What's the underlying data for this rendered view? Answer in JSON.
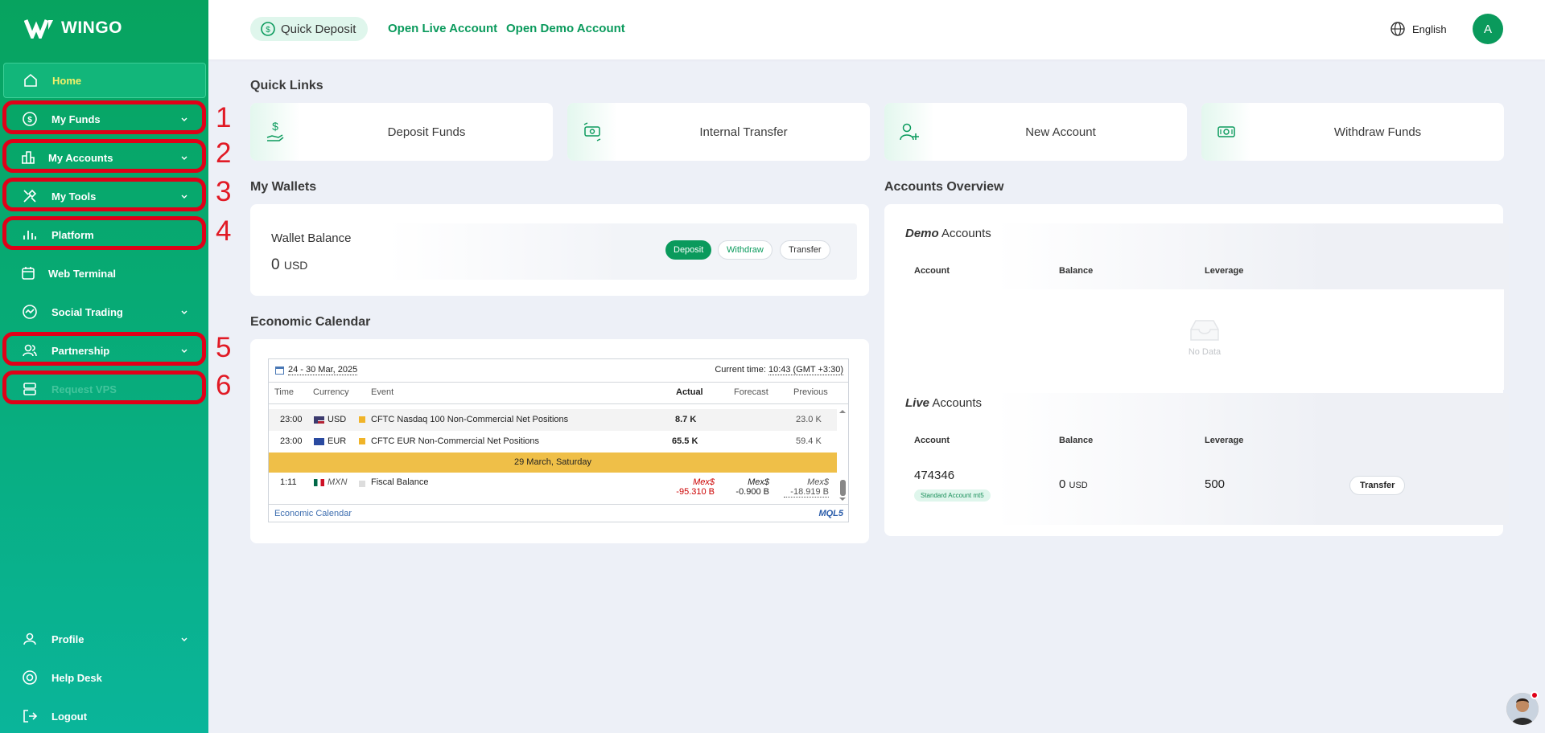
{
  "brand": {
    "name": "WINGO"
  },
  "sidebar": {
    "items": [
      {
        "label": "Home"
      },
      {
        "label": "My Funds"
      },
      {
        "label": "My Accounts"
      },
      {
        "label": "My Tools"
      },
      {
        "label": "Platform"
      },
      {
        "label": "Web Terminal"
      },
      {
        "label": "Social Trading"
      },
      {
        "label": "Partnership"
      },
      {
        "label": "Request VPS"
      },
      {
        "label": "Profile"
      },
      {
        "label": "Help Desk"
      },
      {
        "label": "Logout"
      }
    ],
    "annotations": [
      "1",
      "2",
      "3",
      "4",
      "5",
      "6"
    ]
  },
  "header": {
    "quick_deposit": "Quick Deposit",
    "open_live": "Open Live Account",
    "open_demo": "Open Demo Account",
    "language": "English",
    "avatar_initial": "A"
  },
  "quick_links": {
    "title": "Quick Links",
    "items": [
      {
        "label": "Deposit Funds",
        "icon": "deposit-funds-icon"
      },
      {
        "label": "Internal Transfer",
        "icon": "transfer-icon"
      },
      {
        "label": "New Account",
        "icon": "add-user-icon"
      },
      {
        "label": "Withdraw Funds",
        "icon": "banknote-icon"
      }
    ]
  },
  "wallets": {
    "title": "My Wallets",
    "balance_label": "Wallet Balance",
    "balance_value": "0",
    "balance_currency": "USD",
    "deposit": "Deposit",
    "withdraw": "Withdraw",
    "transfer": "Transfer"
  },
  "calendar": {
    "title": "Economic Calendar",
    "date_range": "24 - 30 Mar, 2025",
    "current_time_label": "Current time:",
    "current_time": "10:43 (GMT +3:30)",
    "columns": {
      "time": "Time",
      "currency": "Currency",
      "event": "Event",
      "actual": "Actual",
      "forecast": "Forecast",
      "previous": "Previous"
    },
    "rows": [
      {
        "time": "23:00",
        "currency": "USD",
        "event": "CFTC Nasdaq 100 Non-Commercial Net Positions",
        "actual": "8.7 K",
        "forecast": "",
        "previous": "23.0 K"
      },
      {
        "time": "23:00",
        "currency": "EUR",
        "event": "CFTC EUR Non-Commercial Net Positions",
        "actual": "65.5 K",
        "forecast": "",
        "previous": "59.4 K"
      }
    ],
    "day_separator": "29 March, Saturday",
    "last_row": {
      "time": "1:11",
      "currency": "MXN",
      "event": "Fiscal Balance",
      "actual_unit": "Mex$",
      "actual": "-95.310 B",
      "forecast_unit": "Mex$",
      "forecast": "-0.900 B",
      "previous_unit": "Mex$",
      "previous": "-18.919 B"
    },
    "footer_link": "Economic Calendar",
    "footer_brand": "MQL5"
  },
  "accounts_overview": {
    "title": "Accounts Overview",
    "demo_title_em": "Demo",
    "demo_title_rest": "Accounts",
    "headers": {
      "account": "Account",
      "balance": "Balance",
      "leverage": "Leverage"
    },
    "no_data": "No Data",
    "live_title_em": "Live",
    "live_title_rest": "Accounts",
    "live_row": {
      "account": "474346",
      "account_type": "Standard Account mt5",
      "balance": "0",
      "currency": "USD",
      "leverage": "500",
      "action": "Transfer"
    }
  },
  "colors": {
    "brand_green": "#0a9a5c",
    "annotation_red": "#e00018",
    "active_label": "#f4f06a"
  }
}
